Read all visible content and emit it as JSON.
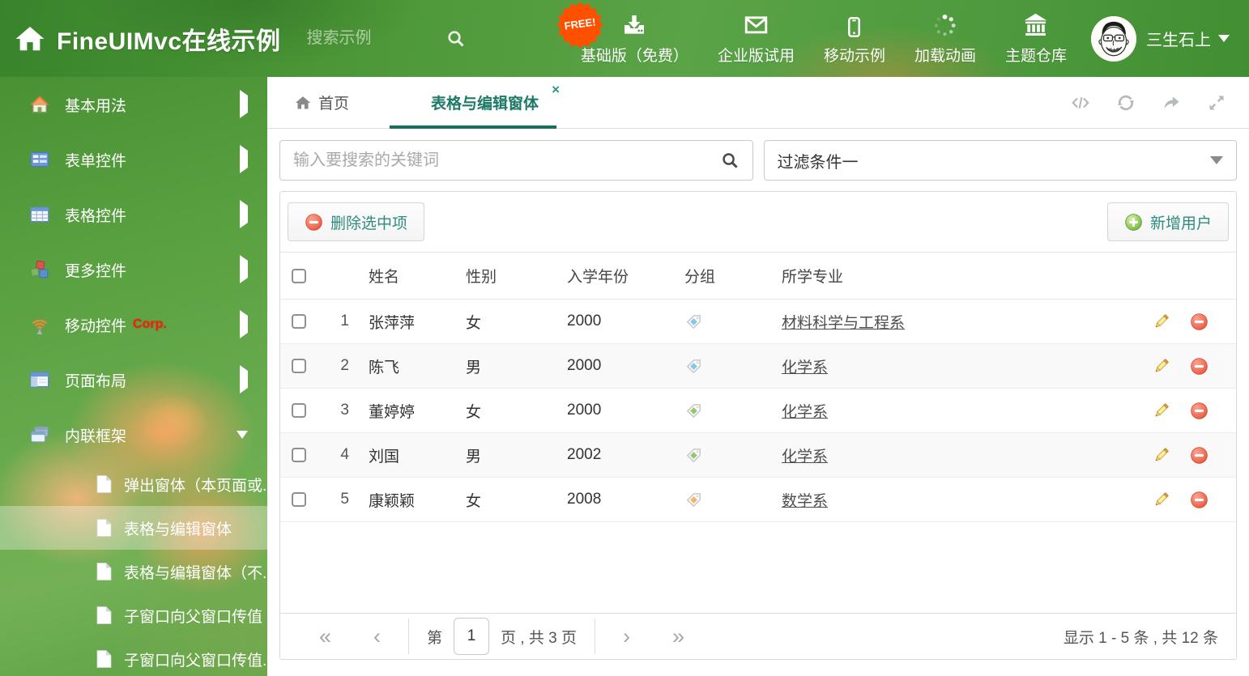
{
  "colors": {
    "theme_green": "#4f9a3c",
    "tab_active_teal": "#1b7b68",
    "button_text_teal": "#2e8b7d",
    "free_badge_orange": "#ff5000",
    "corp_red": "#ff1a00",
    "link_gray": "#4d4d4d"
  },
  "header": {
    "title": "FineUIMvc在线示例",
    "search_placeholder": "搜索示例",
    "free_badge": "FREE!",
    "nav_items": [
      {
        "label": "基础版（免费）",
        "icon": "download"
      },
      {
        "label": "企业版试用",
        "icon": "envelope"
      },
      {
        "label": "移动示例",
        "icon": "mobile"
      },
      {
        "label": "加载动画",
        "icon": "spinner"
      },
      {
        "label": "主题仓库",
        "icon": "bank"
      }
    ],
    "username": "三生石上"
  },
  "sidebar": {
    "items": [
      {
        "label": "基本用法",
        "icon": "home-color"
      },
      {
        "label": "表单控件",
        "icon": "form"
      },
      {
        "label": "表格控件",
        "icon": "grid"
      },
      {
        "label": "更多控件",
        "icon": "cubes"
      },
      {
        "label": "移动控件",
        "badge": "Corp.",
        "icon": "signal"
      },
      {
        "label": "页面布局",
        "icon": "layout"
      },
      {
        "label": "内联框架",
        "icon": "frames",
        "expanded": true
      }
    ],
    "subitems": [
      {
        "label": "弹出窗体（本页面或..."
      },
      {
        "label": "表格与编辑窗体",
        "selected": true
      },
      {
        "label": "表格与编辑窗体（不..."
      },
      {
        "label": "子窗口向父窗口传值"
      },
      {
        "label": "子窗口向父窗口传值..."
      }
    ]
  },
  "tabs": [
    {
      "label": "首页",
      "icon": "home-gray"
    },
    {
      "label": "表格与编辑窗体",
      "active": true,
      "closable": true,
      "close_glyph": "×"
    }
  ],
  "filters": {
    "search_placeholder": "输入要搜索的关键词",
    "filter_value": "过滤条件一"
  },
  "toolbar": {
    "delete_selected": "删除选中项",
    "add_user": "新增用户"
  },
  "table": {
    "columns": [
      "姓名",
      "性别",
      "入学年份",
      "分组",
      "所学专业"
    ],
    "rows": [
      {
        "num": "1",
        "name": "张萍萍",
        "gender": "女",
        "year": "2000",
        "tag_color": "#85c5ee",
        "major": "材料科学与工程系"
      },
      {
        "num": "2",
        "name": "陈飞",
        "gender": "男",
        "year": "2000",
        "tag_color": "#85c5ee",
        "major": "化学系"
      },
      {
        "num": "3",
        "name": "董婷婷",
        "gender": "女",
        "year": "2000",
        "tag_color": "#94c96e",
        "major": "化学系"
      },
      {
        "num": "4",
        "name": "刘国",
        "gender": "男",
        "year": "2002",
        "tag_color": "#94c96e",
        "major": "化学系"
      },
      {
        "num": "5",
        "name": "康颖颖",
        "gender": "女",
        "year": "2008",
        "tag_color": "#f6b26f",
        "major": "数学系"
      }
    ]
  },
  "pagination": {
    "first": "«",
    "prev": "‹",
    "page_label_before": "第",
    "current_page": "1",
    "page_label_after": "页 , 共 3 页",
    "next": "›",
    "last": "»",
    "summary": "显示 1 - 5 条 , 共 12 条"
  }
}
